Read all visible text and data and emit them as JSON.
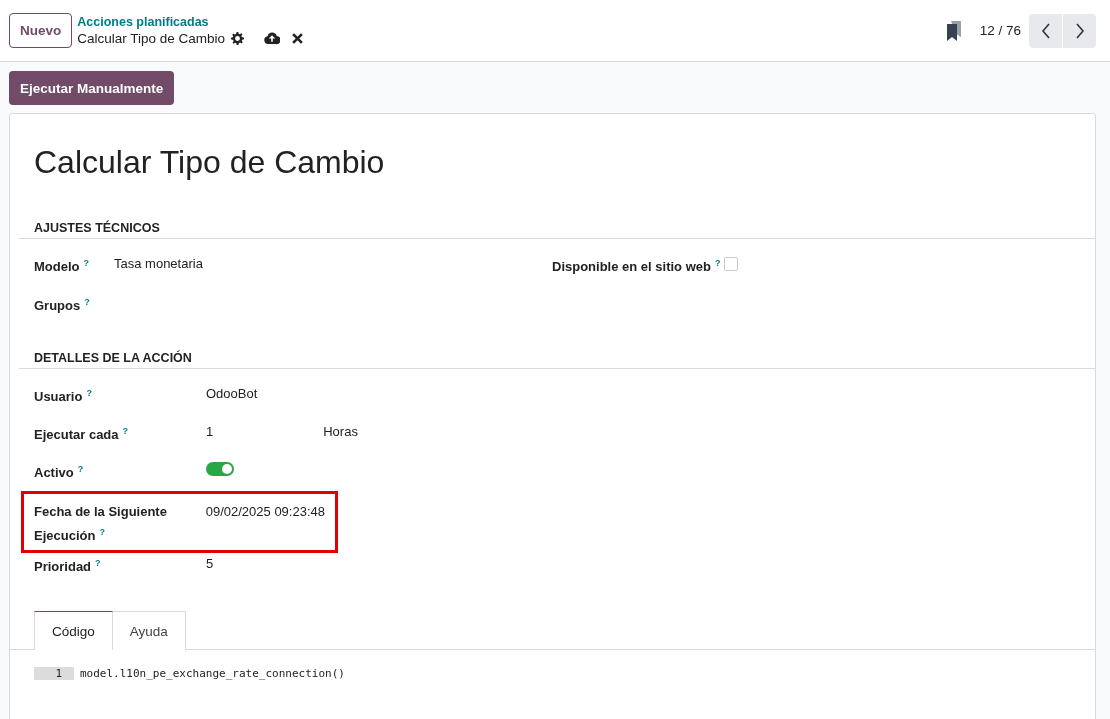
{
  "toolbar": {
    "new_button": "Nuevo",
    "breadcrumb": "Acciones planificadas",
    "record_title": "Calcular Tipo de Cambio",
    "pager": "12 / 76"
  },
  "action_button": "Ejecutar Manualmente",
  "title": "Calcular Tipo de Cambio",
  "sections": [
    {
      "heading": "AJUSTES TÉCNICOS",
      "columns": [
        {
          "fields": [
            {
              "kind": "text",
              "label": "Modelo",
              "help": "?",
              "value": "Tasa monetaria"
            },
            {
              "kind": "text",
              "label": "Grupos",
              "help": "?"
            }
          ]
        },
        {
          "fields": [
            {
              "kind": "checkbox",
              "label": "Disponible en el sitio web",
              "help": "?",
              "checked": false
            }
          ]
        }
      ]
    },
    {
      "heading": "DETALLES DE LA ACCIÓN",
      "fields": [
        {
          "kind": "text",
          "label": "Usuario",
          "help": "?",
          "value": "OdooBot"
        },
        {
          "kind": "interval",
          "label": "Ejecutar cada",
          "help": "?",
          "value": "1",
          "unit": "Horas"
        },
        {
          "kind": "toggle",
          "label": "Activo",
          "help": "?",
          "on": true
        },
        {
          "kind": "text",
          "label": "Fecha de la Siguiente Ejecución",
          "help": "?",
          "value": "09/02/2025 09:23:48",
          "highlighted": true
        },
        {
          "kind": "text",
          "label": "Prioridad",
          "help": "?",
          "value": "5"
        }
      ]
    }
  ],
  "tabs": [
    {
      "label": "Código",
      "selected": true
    },
    {
      "label": "Ayuda",
      "selected": false
    }
  ],
  "code": [
    {
      "line_number": "1",
      "text": "model.l10n_pe_exchange_rate_connection()"
    }
  ]
}
